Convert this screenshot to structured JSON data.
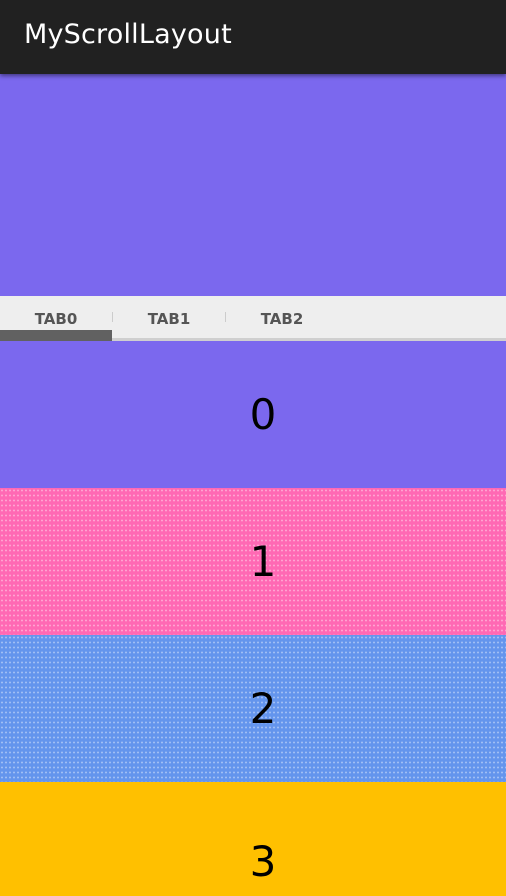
{
  "app": {
    "title": "MyScrollLayout"
  },
  "header_block": {
    "color": "#7b68ee"
  },
  "tabs": [
    {
      "label": "TAB0",
      "selected": true
    },
    {
      "label": "TAB1",
      "selected": false
    },
    {
      "label": "TAB2",
      "selected": false
    }
  ],
  "sections": [
    {
      "label": "0",
      "color": "#7b68ee"
    },
    {
      "label": "1",
      "color": "#ff69b4"
    },
    {
      "label": "2",
      "color": "#6495ed"
    },
    {
      "label": "3",
      "color": "#ffc000"
    }
  ],
  "colors": {
    "action_bar": "#212121",
    "tab_strip": "#eeeeee",
    "tab_indicator": "#616161"
  }
}
